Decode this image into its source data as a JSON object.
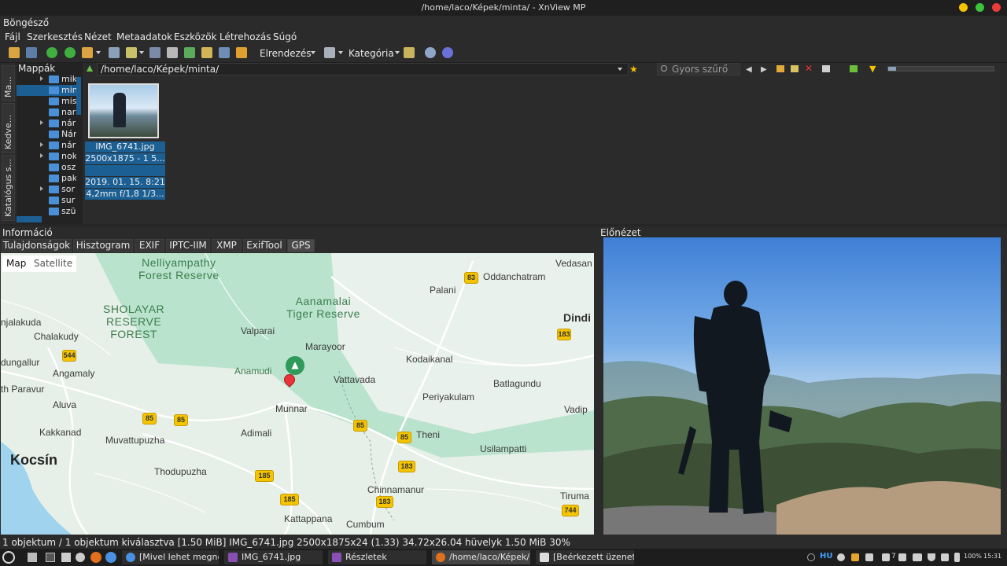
{
  "window": {
    "title": "/home/laco/Képek/minta/ - XnView MP",
    "tab": "Böngésző"
  },
  "menu": [
    "Fájl",
    "Szerkesztés",
    "Nézet",
    "Metaadatok",
    "Eszközök",
    "Létrehozás",
    "Súgó"
  ],
  "toolbar": {
    "sort_label": "Elrendezés",
    "category_label": "Kategória"
  },
  "side_tabs": [
    "Ma...",
    "Kedve...",
    "Katalógus s..."
  ],
  "folders": {
    "header": "Mappák",
    "items": [
      {
        "name": "mik",
        "expandable": true
      },
      {
        "name": "min",
        "expandable": false,
        "selected": true
      },
      {
        "name": "mis",
        "expandable": false
      },
      {
        "name": "nar",
        "expandable": false
      },
      {
        "name": "nár",
        "expandable": true
      },
      {
        "name": "Nár",
        "expandable": false
      },
      {
        "name": "nár",
        "expandable": true
      },
      {
        "name": "nok",
        "expandable": true
      },
      {
        "name": "osz",
        "expandable": false
      },
      {
        "name": "pak",
        "expandable": false
      },
      {
        "name": "sor",
        "expandable": true
      },
      {
        "name": "sur",
        "expandable": false
      },
      {
        "name": "szü",
        "expandable": false
      }
    ]
  },
  "path": "/home/laco/Képek/minta/",
  "filter_placeholder": "Gyors szűrő",
  "thumbnail": {
    "filename": "IMG_6741.jpg",
    "dims": "2500x1875 - 1 5...",
    "blank": "",
    "date": "2019. 01. 15. 8:21",
    "exif": "4,2mm f/1,8 1/3..."
  },
  "info": {
    "header": "Információ",
    "tabs": [
      "Tulajdonságok",
      "Hisztogram",
      "EXIF",
      "IPTC-IIM",
      "XMP",
      "ExifTool",
      "GPS"
    ],
    "active_tab": "GPS",
    "map_toggle": [
      "Map",
      "Satellite"
    ],
    "map_labels": {
      "nelli": "Nelliyampathy\nForest Reserve",
      "sholayar": "SHOLAYAR\nRESERVE\nFOREST",
      "aanamalai": "Aanamalai\nTiger Reserve",
      "palani": "Palani",
      "oddanchatram": "Oddanchatram",
      "vedasan": "Vedasan",
      "dindi": "Dindi",
      "valparai": "Valparai",
      "marayoor": "Marayoor",
      "kodaikanal": "Kodaikanal",
      "anamudi": "Anamudi",
      "vattavada": "Vattavada",
      "batlagundu": "Batlagundu",
      "munnar": "Munnar",
      "periyakulam": "Periyakulam",
      "vadip": "Vadip",
      "adimali": "Adimali",
      "theni": "Theni",
      "muvattupuzha": "Muvattupuzha",
      "usilampatti": "Usilampatti",
      "kocsin": "Kocsín",
      "thodupuzha": "Thodupuzha",
      "chinnamanur": "Chinnamanur",
      "tirumal": "Tiruma",
      "kattappana": "Kattappana",
      "cumbum": "Cumbum",
      "njalakuda": "njalakuda",
      "chalakudy": "Chalakudy",
      "dungallur": "dungallur",
      "angamaly": "Angamaly",
      "parravur": "th Paravur",
      "aluva": "Aluva",
      "kakkanad": "Kakkanad"
    },
    "shields": {
      "s83": "83",
      "s183a": "183",
      "s544": "544",
      "s85a": "85",
      "s85b": "85",
      "s85c": "85",
      "s85d": "85",
      "s185a": "185",
      "s185b": "185",
      "s183b": "183",
      "s183c": "183",
      "s744": "744"
    }
  },
  "preview": {
    "header": "Előnézet"
  },
  "status": "1 objektum / 1 objektum kiválasztva [1.50 MiB]  IMG_6741.jpg  2500x1875x24 (1.33)  34.72x26.04 hüvelyk  1.50 MiB  30%",
  "taskbar": {
    "tasks": [
      "[Mivel lehet megné...",
      "IMG_6741.jpg",
      "Részletek",
      "/home/laco/Képek/...",
      "[Beérkezett üzenete..."
    ],
    "lang": "HU",
    "battery": "100%",
    "clock": "15:31",
    "count": "7"
  },
  "colors": {
    "accent": "#1c5f93",
    "pin": "#e8333a",
    "map_green": "#b7e0c9",
    "shield": "#f4c400"
  }
}
